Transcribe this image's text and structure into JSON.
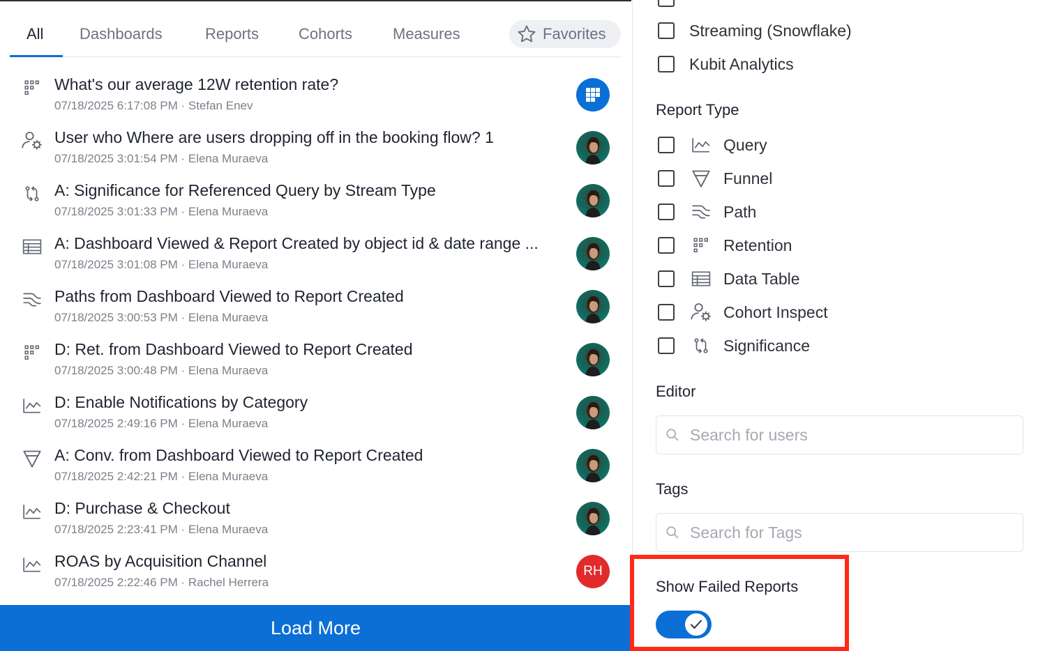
{
  "tabs": [
    {
      "label": "All"
    },
    {
      "label": "Dashboards"
    },
    {
      "label": "Reports"
    },
    {
      "label": "Cohorts"
    },
    {
      "label": "Measures"
    }
  ],
  "favorites_label": "Favorites",
  "items": [
    {
      "icon": "retention-icon",
      "title": "What's our average 12W retention rate?",
      "meta": "07/18/2025 6:17:08 PM · Stefan Enev",
      "avatar": "dashboard-avatar"
    },
    {
      "icon": "cohort-inspect-icon",
      "title": "User who Where are users dropping off in the booking flow? 1",
      "meta": "07/18/2025 3:01:54 PM · Elena Muraeva",
      "avatar": "user-photo"
    },
    {
      "icon": "significance-icon",
      "title": "A: Significance for Referenced Query by Stream Type",
      "meta": "07/18/2025 3:01:33 PM · Elena Muraeva",
      "avatar": "user-photo"
    },
    {
      "icon": "data-table-icon",
      "title": "A: Dashboard Viewed & Report Created by object id & date range ...",
      "meta": "07/18/2025 3:01:08 PM · Elena Muraeva",
      "avatar": "user-photo"
    },
    {
      "icon": "path-icon",
      "title": "Paths from Dashboard Viewed to Report Created",
      "meta": "07/18/2025 3:00:53 PM · Elena Muraeva",
      "avatar": "user-photo"
    },
    {
      "icon": "retention-icon",
      "title": "D: Ret. from Dashboard Viewed to Report Created",
      "meta": "07/18/2025 3:00:48 PM · Elena Muraeva",
      "avatar": "user-photo"
    },
    {
      "icon": "query-icon",
      "title": "D: Enable Notifications by Category",
      "meta": "07/18/2025 2:49:16 PM · Elena Muraeva",
      "avatar": "user-photo"
    },
    {
      "icon": "funnel-icon",
      "title": "A: Conv. from Dashboard Viewed to Report Created",
      "meta": "07/18/2025 2:42:21 PM · Elena Muraeva",
      "avatar": "user-photo"
    },
    {
      "icon": "query-icon",
      "title": "D: Purchase & Checkout",
      "meta": "07/18/2025 2:23:41 PM · Elena Muraeva",
      "avatar": "user-photo"
    },
    {
      "icon": "query-icon",
      "title": "ROAS by Acquisition Channel",
      "meta": "07/18/2025 2:22:46 PM · Rachel Herrera",
      "avatar": "initials",
      "initials": "RH"
    }
  ],
  "load_more_label": "Load More",
  "sources": [
    {
      "label": "Streaming (Snowflake)"
    },
    {
      "label": "Kubit Analytics"
    }
  ],
  "report_type": {
    "title": "Report Type",
    "options": [
      {
        "icon": "query-icon",
        "label": "Query"
      },
      {
        "icon": "funnel-icon",
        "label": "Funnel"
      },
      {
        "icon": "path-icon",
        "label": "Path"
      },
      {
        "icon": "retention-icon",
        "label": "Retention"
      },
      {
        "icon": "data-table-icon",
        "label": "Data Table"
      },
      {
        "icon": "cohort-inspect-icon",
        "label": "Cohort Inspect"
      },
      {
        "icon": "significance-icon",
        "label": "Significance"
      }
    ]
  },
  "editor": {
    "title": "Editor",
    "placeholder": "Search for users"
  },
  "tags": {
    "title": "Tags",
    "placeholder": "Search for Tags"
  },
  "failed": {
    "title": "Show Failed Reports",
    "enabled": true
  },
  "colors": {
    "accent": "#0b6fd6",
    "highlight": "#ff2a17",
    "rh_avatar": "#e12b2b"
  }
}
